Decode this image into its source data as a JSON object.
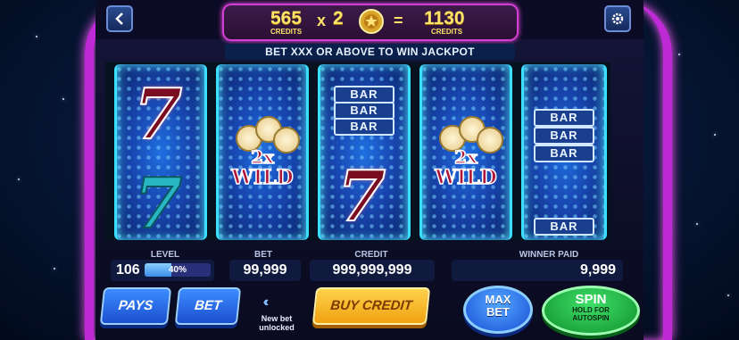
{
  "header": {
    "bet_amount": "565",
    "bet_unit": "CREDITS",
    "multiply_symbol": "x",
    "multiplier": "2",
    "equals_symbol": "=",
    "win_amount": "1130",
    "win_unit": "CREDITS"
  },
  "jackpot_banner": "BET XXX OR ABOVE TO WIN JACKPOT",
  "reels": {
    "bar_label": "BAR",
    "wild_label": "WILD",
    "wild_multiplier": "2x",
    "seven_label": "7"
  },
  "stats": {
    "level_label": "LEVEL",
    "level": "106",
    "level_progress_text": "40%",
    "level_progress": 0.4,
    "bet_label": "BET",
    "bet": "99,999",
    "credit_label": "CREDIT",
    "credit": "999,999,999",
    "winner_paid_label": "WINNER PAID",
    "winner_paid": "9,999"
  },
  "controls": {
    "pays": "PAYS",
    "bet": "BET",
    "unlock_text_1": "New bet",
    "unlock_text_2": "unlocked",
    "buy_credit": "BUY CREDIT",
    "max_bet_1": "MAX",
    "max_bet_2": "BET",
    "spin": "SPIN",
    "spin_sub_1": "HOLD FOR",
    "spin_sub_2": "AUTOSPIN"
  },
  "colors": {
    "frame_neon": "#c02ad6",
    "credit_gold": "#ffe46a",
    "reel_blue": "#1846b0",
    "seven_red": "#7a0d22",
    "seven_teal": "#27b6c2",
    "spin_green": "#0f8f2b"
  },
  "icons": [
    "back-icon",
    "gear-icon",
    "coin-icon",
    "chevrons-left-icon"
  ]
}
